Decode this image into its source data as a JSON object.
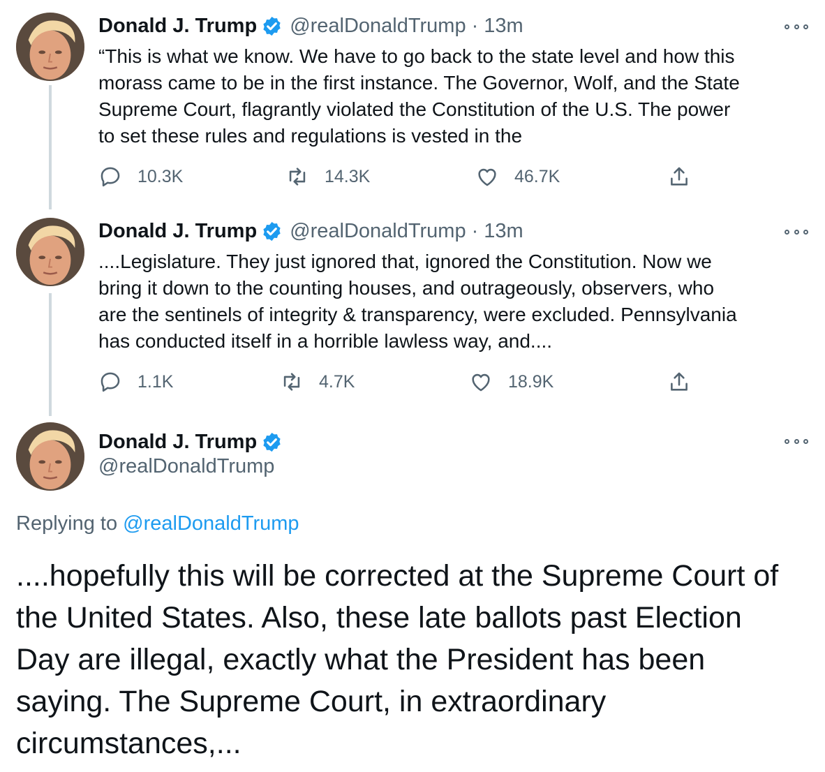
{
  "colors": {
    "accent": "#1d9bf0",
    "secondary_text": "#536471",
    "primary_text": "#0f1419",
    "thread_line": "#cfd9de"
  },
  "tweets": [
    {
      "name": "Donald J. Trump",
      "handle": "@realDonaldTrump",
      "separator": "·",
      "time": "13m",
      "verified_icon": "verified-badge-icon",
      "text_lines": [
        "“This is what we know. We have to go back to the state level and how this",
        "morass came to be in the first instance. The Governor, Wolf, and the State",
        "Supreme Court, flagrantly violated the Constitution of the U.S. The power",
        "to set these rules and regulations is vested in the"
      ],
      "replies": "10.3K",
      "retweets": "14.3K",
      "likes": "46.7K"
    },
    {
      "name": "Donald J. Trump",
      "handle": "@realDonaldTrump",
      "separator": "·",
      "time": "13m",
      "verified_icon": "verified-badge-icon",
      "text_lines": [
        "....Legislature. They just ignored that, ignored the Constitution. Now we",
        "bring it down to the counting houses, and outrageously, observers, who",
        "are the sentinels of integrity & transparency, were excluded. Pennsylvania",
        "has conducted itself in a horrible lawless way, and...."
      ],
      "replies": "1.1K",
      "retweets": "4.7K",
      "likes": "18.9K"
    }
  ],
  "main_tweet": {
    "name": "Donald J. Trump",
    "handle": "@realDonaldTrump",
    "verified_icon": "verified-badge-icon",
    "replying_prefix": "Replying to",
    "replying_to": "@realDonaldTrump",
    "text_lines": [
      "....hopefully this will be corrected at the Supreme Court of",
      "the United States. Also, these late ballots past Election",
      "Day are illegal, exactly what the President has been",
      "saying. The Supreme Court, in extraordinary",
      "circumstances,..."
    ]
  },
  "icons": {
    "reply": "reply-icon",
    "retweet": "retweet-icon",
    "like": "like-icon",
    "share": "share-icon",
    "more": "more-options-icon"
  }
}
